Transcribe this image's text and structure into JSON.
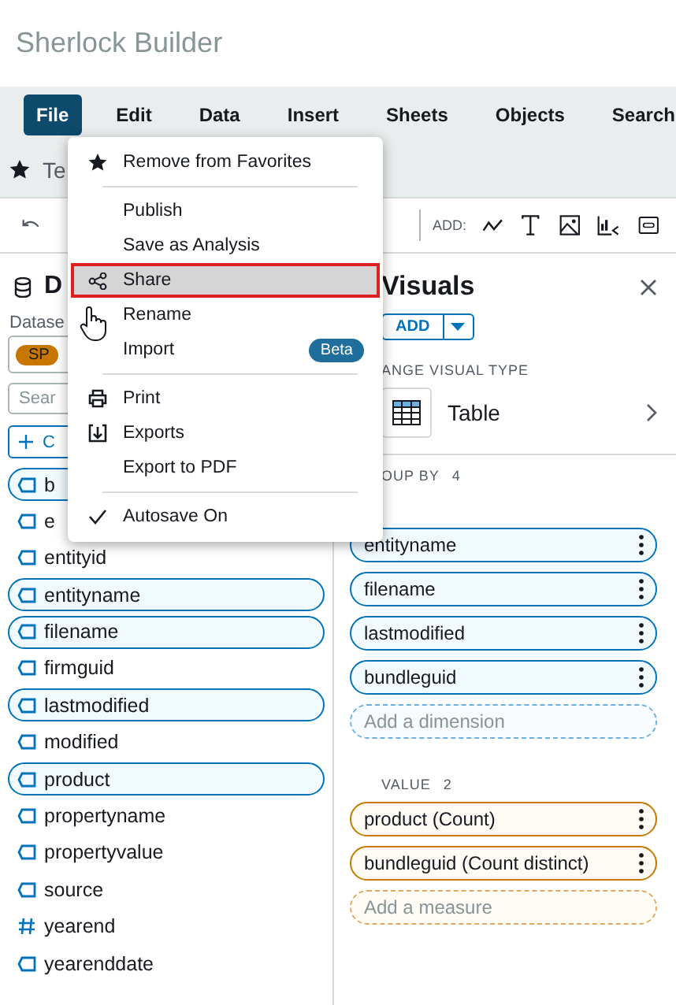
{
  "app_title": "Sherlock Builder",
  "menu_bar": [
    {
      "label": "File",
      "selected": true
    },
    {
      "label": "Edit",
      "selected": false
    },
    {
      "label": "Data",
      "selected": false
    },
    {
      "label": "Insert",
      "selected": false
    },
    {
      "label": "Sheets",
      "selected": false
    },
    {
      "label": "Objects",
      "selected": false
    },
    {
      "label": "Search",
      "selected": false
    }
  ],
  "tab": {
    "label": "Te"
  },
  "toolbar": {
    "add_label": "ADD:"
  },
  "data_panel": {
    "title": "D",
    "dataset_label": "Datase",
    "dataset_chip": "SP",
    "search": {
      "placeholder": "Sear"
    },
    "create_button": "C",
    "fields": [
      {
        "name": "b",
        "kind": "text",
        "selected": true
      },
      {
        "name": "e",
        "kind": "text",
        "selected": false
      },
      {
        "name": "entityid",
        "kind": "text",
        "selected": false
      },
      {
        "name": "entityname",
        "kind": "text",
        "selected": true
      },
      {
        "name": "filename",
        "kind": "text",
        "selected": true
      },
      {
        "name": "firmguid",
        "kind": "text",
        "selected": false
      },
      {
        "name": "lastmodified",
        "kind": "text",
        "selected": true
      },
      {
        "name": "modified",
        "kind": "text",
        "selected": false
      },
      {
        "name": "product",
        "kind": "text",
        "selected": true
      },
      {
        "name": "propertyname",
        "kind": "text",
        "selected": false
      },
      {
        "name": "propertyvalue",
        "kind": "text",
        "selected": false
      },
      {
        "name": "source",
        "kind": "text",
        "selected": false
      },
      {
        "name": "yearend",
        "kind": "number",
        "selected": false
      },
      {
        "name": "yearenddate",
        "kind": "text",
        "selected": false
      }
    ]
  },
  "file_menu": {
    "items": [
      {
        "kind": "favorite",
        "label": "Remove from Favorites",
        "selected": false
      },
      {
        "kind": "divider"
      },
      {
        "kind": "plain",
        "label": "Publish",
        "selected": false
      },
      {
        "kind": "plain",
        "label": "Save as Analysis",
        "selected": false
      },
      {
        "kind": "share",
        "label": "Share",
        "selected": true
      },
      {
        "kind": "plain",
        "label": "Rename",
        "selected": false
      },
      {
        "kind": "plain",
        "label": "Import",
        "badge": "Beta",
        "selected": false
      },
      {
        "kind": "divider"
      },
      {
        "kind": "print",
        "label": "Print",
        "selected": false
      },
      {
        "kind": "export",
        "label": "Exports",
        "selected": false
      },
      {
        "kind": "plain",
        "label": "Export to PDF",
        "selected": false
      },
      {
        "kind": "divider"
      },
      {
        "kind": "toggle",
        "label": "Autosave On",
        "checked": true,
        "selected": false
      }
    ]
  },
  "visuals_panel": {
    "title": "Visuals",
    "add_button": "ADD",
    "visual_type_label": "ANGE VISUAL TYPE",
    "visual_type": "Table",
    "wells": [
      {
        "kind": "dimension",
        "label": "OUP BY",
        "count": "4",
        "fields": [
          "entityname",
          "filename",
          "lastmodified",
          "bundleguid"
        ],
        "placeholder": "Add a dimension"
      },
      {
        "kind": "measure",
        "label": "VALUE",
        "count": "2",
        "fields": [
          "product (Count)",
          "bundleguid (Count distinct)"
        ],
        "placeholder": "Add a measure"
      }
    ]
  }
}
